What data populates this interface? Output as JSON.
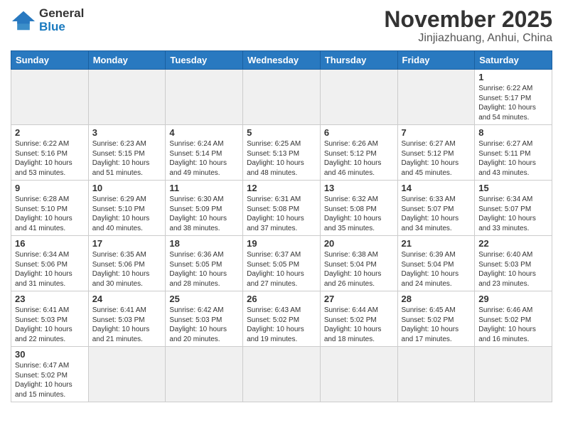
{
  "header": {
    "logo_general": "General",
    "logo_blue": "Blue",
    "title": "November 2025",
    "subtitle": "Jinjiazhuang, Anhui, China"
  },
  "days_of_week": [
    "Sunday",
    "Monday",
    "Tuesday",
    "Wednesday",
    "Thursday",
    "Friday",
    "Saturday"
  ],
  "weeks": [
    [
      {
        "day": "",
        "info": ""
      },
      {
        "day": "",
        "info": ""
      },
      {
        "day": "",
        "info": ""
      },
      {
        "day": "",
        "info": ""
      },
      {
        "day": "",
        "info": ""
      },
      {
        "day": "",
        "info": ""
      },
      {
        "day": "1",
        "info": "Sunrise: 6:22 AM\nSunset: 5:17 PM\nDaylight: 10 hours\nand 54 minutes."
      }
    ],
    [
      {
        "day": "2",
        "info": "Sunrise: 6:22 AM\nSunset: 5:16 PM\nDaylight: 10 hours\nand 53 minutes."
      },
      {
        "day": "3",
        "info": "Sunrise: 6:23 AM\nSunset: 5:15 PM\nDaylight: 10 hours\nand 51 minutes."
      },
      {
        "day": "4",
        "info": "Sunrise: 6:24 AM\nSunset: 5:14 PM\nDaylight: 10 hours\nand 49 minutes."
      },
      {
        "day": "5",
        "info": "Sunrise: 6:25 AM\nSunset: 5:13 PM\nDaylight: 10 hours\nand 48 minutes."
      },
      {
        "day": "6",
        "info": "Sunrise: 6:26 AM\nSunset: 5:12 PM\nDaylight: 10 hours\nand 46 minutes."
      },
      {
        "day": "7",
        "info": "Sunrise: 6:27 AM\nSunset: 5:12 PM\nDaylight: 10 hours\nand 45 minutes."
      },
      {
        "day": "8",
        "info": "Sunrise: 6:27 AM\nSunset: 5:11 PM\nDaylight: 10 hours\nand 43 minutes."
      }
    ],
    [
      {
        "day": "9",
        "info": "Sunrise: 6:28 AM\nSunset: 5:10 PM\nDaylight: 10 hours\nand 41 minutes."
      },
      {
        "day": "10",
        "info": "Sunrise: 6:29 AM\nSunset: 5:10 PM\nDaylight: 10 hours\nand 40 minutes."
      },
      {
        "day": "11",
        "info": "Sunrise: 6:30 AM\nSunset: 5:09 PM\nDaylight: 10 hours\nand 38 minutes."
      },
      {
        "day": "12",
        "info": "Sunrise: 6:31 AM\nSunset: 5:08 PM\nDaylight: 10 hours\nand 37 minutes."
      },
      {
        "day": "13",
        "info": "Sunrise: 6:32 AM\nSunset: 5:08 PM\nDaylight: 10 hours\nand 35 minutes."
      },
      {
        "day": "14",
        "info": "Sunrise: 6:33 AM\nSunset: 5:07 PM\nDaylight: 10 hours\nand 34 minutes."
      },
      {
        "day": "15",
        "info": "Sunrise: 6:34 AM\nSunset: 5:07 PM\nDaylight: 10 hours\nand 33 minutes."
      }
    ],
    [
      {
        "day": "16",
        "info": "Sunrise: 6:34 AM\nSunset: 5:06 PM\nDaylight: 10 hours\nand 31 minutes."
      },
      {
        "day": "17",
        "info": "Sunrise: 6:35 AM\nSunset: 5:06 PM\nDaylight: 10 hours\nand 30 minutes."
      },
      {
        "day": "18",
        "info": "Sunrise: 6:36 AM\nSunset: 5:05 PM\nDaylight: 10 hours\nand 28 minutes."
      },
      {
        "day": "19",
        "info": "Sunrise: 6:37 AM\nSunset: 5:05 PM\nDaylight: 10 hours\nand 27 minutes."
      },
      {
        "day": "20",
        "info": "Sunrise: 6:38 AM\nSunset: 5:04 PM\nDaylight: 10 hours\nand 26 minutes."
      },
      {
        "day": "21",
        "info": "Sunrise: 6:39 AM\nSunset: 5:04 PM\nDaylight: 10 hours\nand 24 minutes."
      },
      {
        "day": "22",
        "info": "Sunrise: 6:40 AM\nSunset: 5:03 PM\nDaylight: 10 hours\nand 23 minutes."
      }
    ],
    [
      {
        "day": "23",
        "info": "Sunrise: 6:41 AM\nSunset: 5:03 PM\nDaylight: 10 hours\nand 22 minutes."
      },
      {
        "day": "24",
        "info": "Sunrise: 6:41 AM\nSunset: 5:03 PM\nDaylight: 10 hours\nand 21 minutes."
      },
      {
        "day": "25",
        "info": "Sunrise: 6:42 AM\nSunset: 5:03 PM\nDaylight: 10 hours\nand 20 minutes."
      },
      {
        "day": "26",
        "info": "Sunrise: 6:43 AM\nSunset: 5:02 PM\nDaylight: 10 hours\nand 19 minutes."
      },
      {
        "day": "27",
        "info": "Sunrise: 6:44 AM\nSunset: 5:02 PM\nDaylight: 10 hours\nand 18 minutes."
      },
      {
        "day": "28",
        "info": "Sunrise: 6:45 AM\nSunset: 5:02 PM\nDaylight: 10 hours\nand 17 minutes."
      },
      {
        "day": "29",
        "info": "Sunrise: 6:46 AM\nSunset: 5:02 PM\nDaylight: 10 hours\nand 16 minutes."
      }
    ],
    [
      {
        "day": "30",
        "info": "Sunrise: 6:47 AM\nSunset: 5:02 PM\nDaylight: 10 hours\nand 15 minutes."
      },
      {
        "day": "",
        "info": ""
      },
      {
        "day": "",
        "info": ""
      },
      {
        "day": "",
        "info": ""
      },
      {
        "day": "",
        "info": ""
      },
      {
        "day": "",
        "info": ""
      },
      {
        "day": "",
        "info": ""
      }
    ]
  ]
}
